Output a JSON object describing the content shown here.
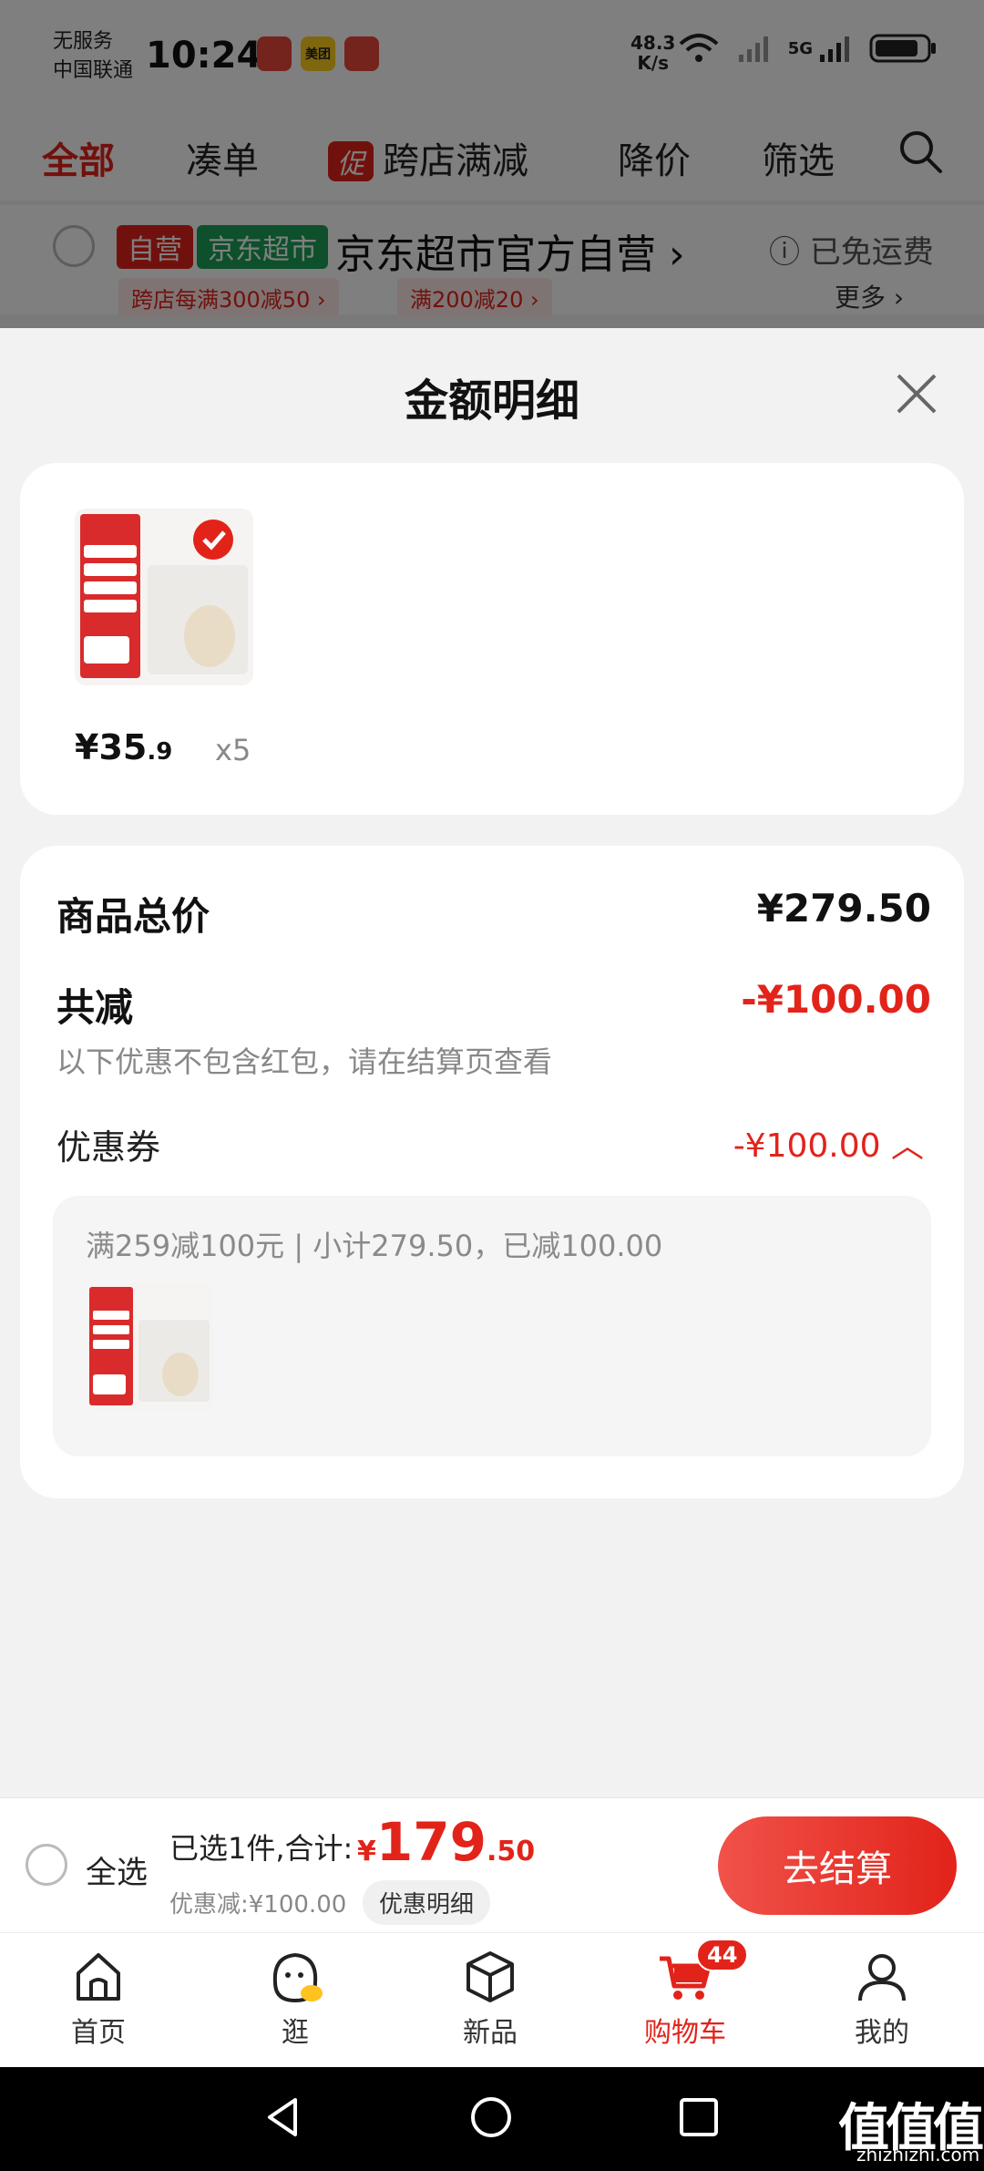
{
  "status": {
    "carrier_line1": "无服务",
    "carrier_line2": "中国联通",
    "time": "10:24",
    "apps": [
      "",
      "美团",
      ""
    ],
    "net_speed_value": "48.3",
    "net_speed_unit": "K/s",
    "network": "5G"
  },
  "nav": {
    "tabs": [
      "全部",
      "凑单",
      "跨店满减",
      "降价",
      "筛选"
    ],
    "promo_badge": "促"
  },
  "shop": {
    "tag_self": "自营",
    "tag_market": "京东超市",
    "name": "京东超市官方自营 ›",
    "free_shipping": "ⓘ 已免运费",
    "promo1": "跨店每满300减50 ›",
    "promo2": "满200减20 ›",
    "more": "更多 ›"
  },
  "sheet": {
    "title": "金额明细",
    "item_price_int": "¥35",
    "item_price_dec": ".9",
    "item_qty": "x5",
    "total_label": "商品总价",
    "total_value": "¥279.50",
    "reduce_label": "共减",
    "reduce_value": "-¥100.00",
    "note": "以下优惠不包含红包，请在结算页查看",
    "coupon_label": "优惠券",
    "coupon_value": "-¥100.00 ︿",
    "coupon_desc": "满259减100元 | 小计279.50，已减100.00"
  },
  "checkout": {
    "select_all": "全选",
    "selected": "已选1件,合计:",
    "currency": "¥",
    "total_int": "179",
    "total_dec": ".50",
    "discount": "优惠减:¥100.00",
    "detail": "优惠明细",
    "button": "去结算"
  },
  "tabbar": {
    "items": [
      "首页",
      "逛",
      "新品",
      "购物车",
      "我的"
    ],
    "cart_count": "44"
  },
  "watermark": {
    "main": "值值值",
    "sub": "zhizhizhi.com"
  },
  "colors": {
    "accent": "#e2231a",
    "green": "#1aa157"
  }
}
